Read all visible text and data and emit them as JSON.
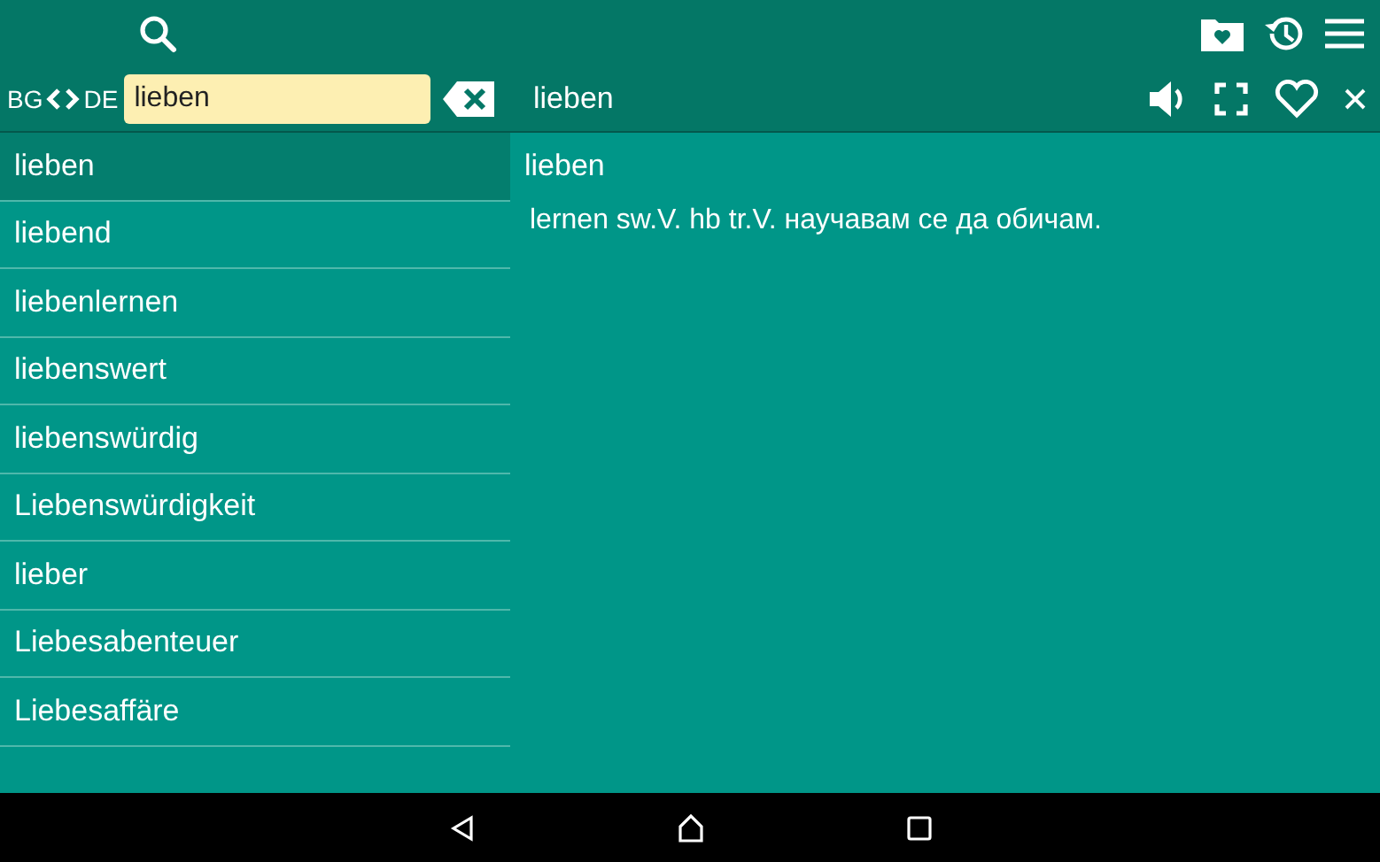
{
  "search_bar": {
    "source_lang": "BG",
    "target_lang": "DE",
    "query": "lieben"
  },
  "entry_header": {
    "word": "lieben"
  },
  "word_list": [
    {
      "word": "lieben",
      "selected": true
    },
    {
      "word": "liebend",
      "selected": false
    },
    {
      "word": "liebenlernen",
      "selected": false
    },
    {
      "word": "liebenswert",
      "selected": false
    },
    {
      "word": "liebenswürdig",
      "selected": false
    },
    {
      "word": "Liebenswürdigkeit",
      "selected": false
    },
    {
      "word": "lieber",
      "selected": false
    },
    {
      "word": "Liebesabenteuer",
      "selected": false
    },
    {
      "word": "Liebesaffäre",
      "selected": false
    }
  ],
  "entry": {
    "headword": "lieben",
    "definition": "lernen sw.V. hb tr.V. научавам се да обичам."
  }
}
